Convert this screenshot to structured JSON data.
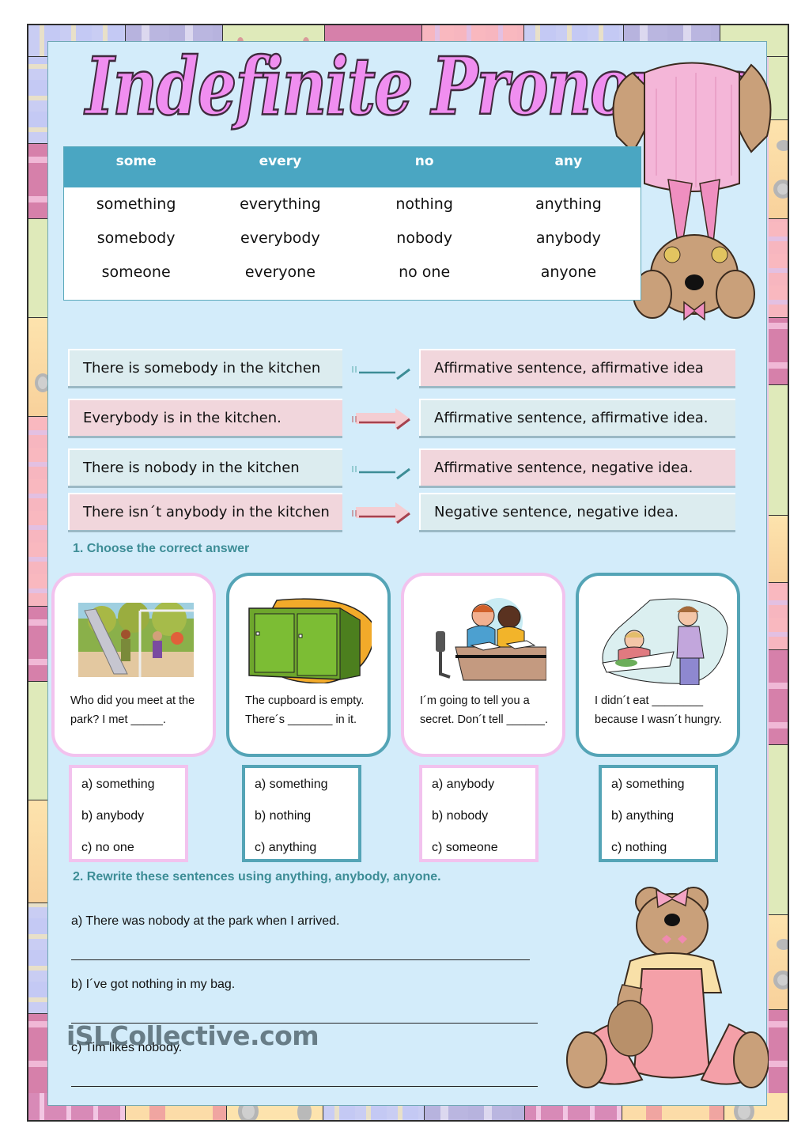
{
  "title": "Indefinite Pronouns",
  "pronoun_table": {
    "headers": [
      "some",
      "every",
      "no",
      "any"
    ],
    "rows": [
      [
        "something",
        "everything",
        "nothing",
        "anything"
      ],
      [
        "somebody",
        "everybody",
        "nobody",
        "anybody"
      ],
      [
        "someone",
        "everyone",
        "no one",
        "anyone"
      ]
    ]
  },
  "examples": [
    {
      "sentence": "There is somebody in the kitchen",
      "explanation": "Affirmative sentence, affirmative idea"
    },
    {
      "sentence": "Everybody is in the kitchen.",
      "explanation": "Affirmative sentence,  affirmative idea."
    },
    {
      "sentence": "There is nobody in the kitchen",
      "explanation": "Affirmative sentence, negative idea."
    },
    {
      "sentence": "There isn´t anybody in the kitchen",
      "explanation": "Negative sentence, negative idea."
    }
  ],
  "exercise1": {
    "heading": "1. Choose the correct answer",
    "questions": [
      {
        "picture": "park-playground-image",
        "text": "Who did you meet  at the park? I met _____.",
        "options": [
          "a) something",
          "b) anybody",
          "c) no one"
        ]
      },
      {
        "picture": "green-cupboard-image",
        "text": "The cupboard is empty. There´s _______ in it.",
        "options": [
          "a) something",
          "b) nothing",
          "c) anything"
        ]
      },
      {
        "picture": "kids-whispering-image",
        "text": "I´m going to tell you a secret. Don´t tell ______.",
        "options": [
          "a) anybody",
          "b) nobody",
          "c) someone"
        ]
      },
      {
        "picture": "girl-not-eating-image",
        "text": "I didn´t eat  ________ because I wasn´t hungry.",
        "options": [
          "a) something",
          "b) anything",
          "c) nothing"
        ]
      }
    ]
  },
  "exercise2": {
    "heading": "2. Rewrite these sentences using anything, anybody, anyone.",
    "items": [
      "a) There was nobody at the park when I arrived.",
      "b) I´ve got nothing in my bag.",
      "c) Tim likes nobody."
    ]
  },
  "watermark": "iSLCollective.com",
  "colors": {
    "title_pink": "#f08ef0",
    "table_header": "#4aa6c2",
    "heading_teal": "#3d8d96",
    "card_pink": "#f2c2ee",
    "card_teal": "#54a4b6",
    "page_bg": "#d3ecfa"
  }
}
